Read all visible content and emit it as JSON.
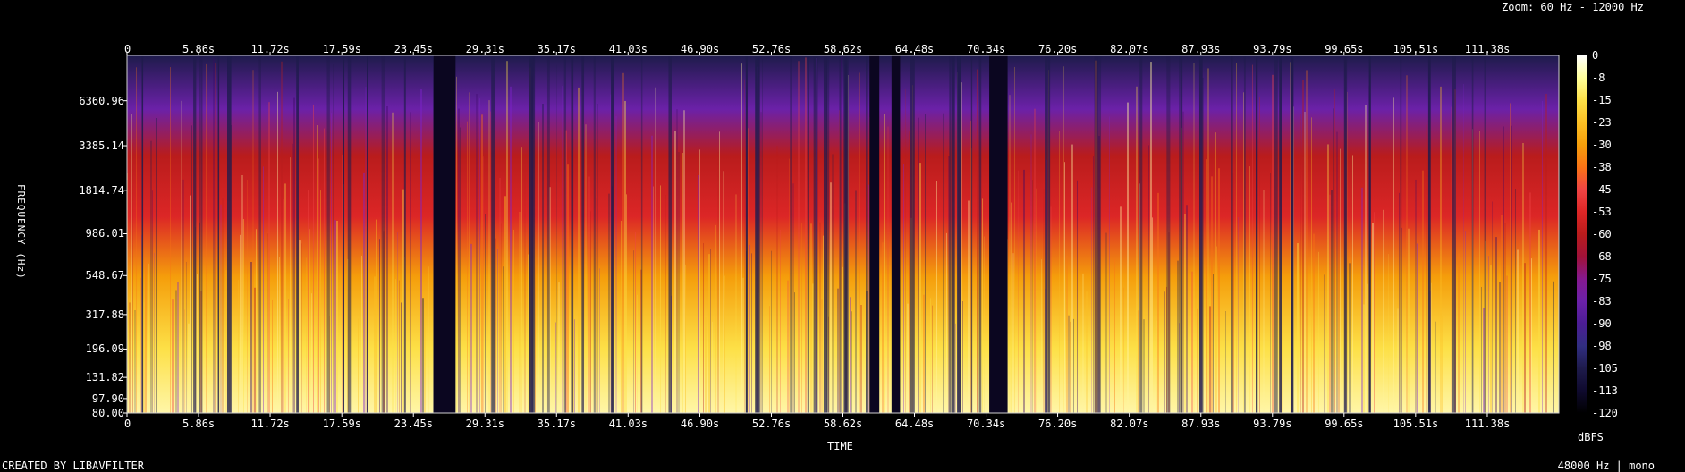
{
  "header": {
    "zoom_text": "Zoom: 60 Hz - 12000 Hz"
  },
  "footer": {
    "created_by": "CREATED BY LIBAVFILTER",
    "audio_info": "48000 Hz | mono"
  },
  "colorbar": {
    "unit": "dBFS",
    "ticks": [
      "0",
      "-8",
      "-15",
      "-23",
      "-30",
      "-38",
      "-45",
      "-53",
      "-60",
      "-68",
      "-75",
      "-83",
      "-90",
      "-98",
      "-105",
      "-113",
      "-120"
    ],
    "stops": [
      "#ffffff",
      "#ffff9a",
      "#fde047",
      "#fbbf24",
      "#f59e0b",
      "#f97316",
      "#ef4444",
      "#dc2626",
      "#b91c1c",
      "#9f1239",
      "#86198f",
      "#6b21a8",
      "#4c1d95",
      "#312e81",
      "#1e1b4b",
      "#0f0a2e",
      "#000000"
    ]
  },
  "chart_data": {
    "type": "heatmap",
    "title": "",
    "xlabel": "TIME",
    "ylabel": "FREQUENCY (Hz)",
    "x_ticks": [
      "0",
      "5.86s",
      "11.72s",
      "17.59s",
      "23.45s",
      "29.31s",
      "35.17s",
      "41.03s",
      "46.90s",
      "52.76s",
      "58.62s",
      "64.48s",
      "70.34s",
      "76.20s",
      "82.07s",
      "87.93s",
      "93.79s",
      "99.65s",
      "105.51s",
      "111.38s"
    ],
    "x_tick_values": [
      0,
      5.86,
      11.72,
      17.59,
      23.45,
      29.31,
      35.17,
      41.03,
      46.9,
      52.76,
      58.62,
      64.48,
      70.34,
      76.2,
      82.07,
      87.93,
      93.79,
      99.65,
      105.51,
      111.38
    ],
    "xlim": [
      0,
      117.24
    ],
    "y_ticks": [
      "6360.96",
      "3385.14",
      "1814.74",
      "986.01",
      "548.67",
      "317.88",
      "196.09",
      "131.82",
      "97.90",
      "80.00"
    ],
    "y_tick_values": [
      6360.96,
      3385.14,
      1814.74,
      986.01,
      548.67,
      317.88,
      196.09,
      131.82,
      97.9,
      80.0
    ],
    "y_scale": "log",
    "zlim": [
      -120,
      0
    ],
    "z_unit": "dBFS",
    "silent_segments_s": [
      [
        25.1,
        26.9
      ],
      [
        60.8,
        61.6
      ],
      [
        62.6,
        63.3
      ],
      [
        70.6,
        72.1
      ]
    ]
  }
}
